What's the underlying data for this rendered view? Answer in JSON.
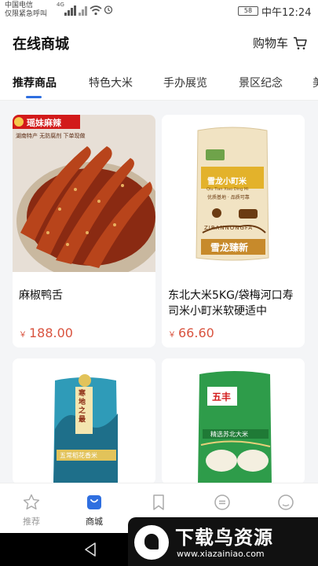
{
  "status_bar": {
    "carrier_line1": "中国电信",
    "carrier_line2": "仅限紧急呼叫",
    "network": "4G",
    "battery": "58",
    "time": "中午12:24"
  },
  "header": {
    "title": "在线商城",
    "cart_label": "购物车",
    "cart_icon": "cart-icon"
  },
  "tabs": [
    {
      "label": "推荐商品",
      "active": true
    },
    {
      "label": "特色大米"
    },
    {
      "label": "手办展览"
    },
    {
      "label": "景区纪念"
    },
    {
      "label": "美"
    }
  ],
  "products": [
    {
      "name": "麻椒鸭舌",
      "price": "188.00",
      "banner": "瑶妹麻辣",
      "banner_sub": "湖南特产 无防腐剂 下单现做"
    },
    {
      "name": "东北大米5KG/袋梅河口寿 司米小町米软硬适中",
      "price": "66.60",
      "bag_title": "雪龙小町米",
      "bag_pinyin": "Qiu Tian Xiao Ding Mi",
      "bag_sub": "优质基地 · 品质可靠",
      "bag_brand_en": "ZIRANNONGFA",
      "bag_brand": "雪龙臻新"
    },
    {
      "name": "",
      "price": "",
      "bag_title": "寒地之最",
      "bag_sub": "五常稻花香米"
    },
    {
      "name": "",
      "price": "",
      "bag_brand": "五丰",
      "bag_sub": "精选苏北大米"
    }
  ],
  "currency": "￥",
  "bottom_nav": [
    {
      "label": "推荐",
      "icon": "star-icon"
    },
    {
      "label": "商城",
      "icon": "shop-bag-icon",
      "active": true
    },
    {
      "label": "",
      "icon": "bookmark-icon"
    },
    {
      "label": "",
      "icon": "message-icon"
    },
    {
      "label": "",
      "icon": "profile-icon"
    }
  ],
  "watermark": {
    "title": "下载鸟资源",
    "url": "www.xiazainiao.com"
  },
  "colors": {
    "accent": "#2f6fe0",
    "price": "#d9533f",
    "background": "#f4f5f7"
  }
}
